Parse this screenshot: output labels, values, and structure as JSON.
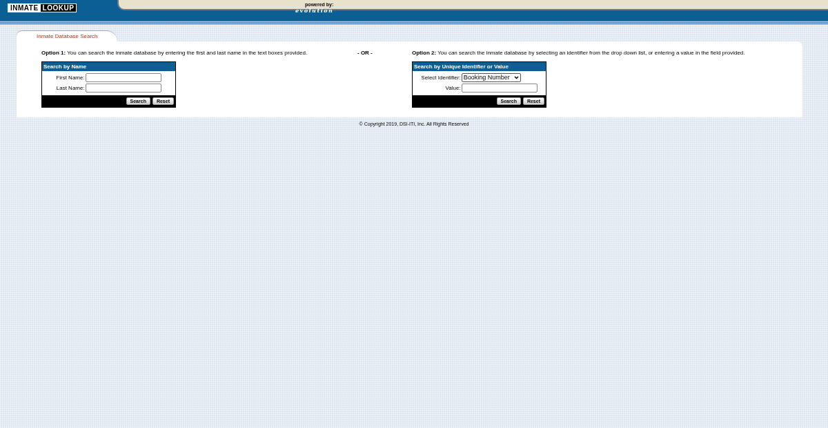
{
  "header": {
    "logo": [
      "INMATE",
      "LOOKUP"
    ],
    "powered_by": "powered by:",
    "brand": "evolution"
  },
  "tabs": [
    {
      "label": "Inmate Database Search",
      "selected": true
    }
  ],
  "options": [
    {
      "label": "Option 1:",
      "text": "You can search the inmate database by entering the first and last name in the text boxes provided.",
      "panel": {
        "title": "Search by Name",
        "fields": [
          {
            "kind": "text",
            "label": "First Name:"
          },
          {
            "kind": "text",
            "label": "Last Name:"
          }
        ],
        "buttons": [
          "Search",
          "Reset"
        ]
      }
    },
    {
      "label": "Option 2:",
      "text": "You can search the inmate database by selecting an identifier from the drop down list, or entering a value in the field provided.",
      "panel": {
        "title": "Search by Unique Identifier or Value",
        "fields": [
          {
            "kind": "select",
            "label": "Select Identifier:",
            "value": "Booking Number"
          },
          {
            "kind": "text",
            "label": "Value:"
          }
        ],
        "buttons": [
          "Search",
          "Reset"
        ]
      }
    }
  ],
  "separator": "- OR -",
  "footer": "© Copyright 2019, DSI-ITI, Inc. All Rights Reserved"
}
